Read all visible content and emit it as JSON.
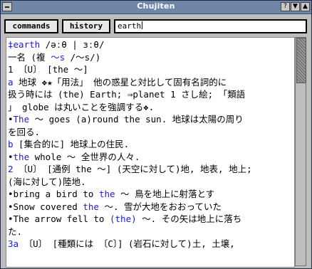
{
  "window": {
    "title": "Chujiten"
  },
  "titlebar_buttons": [
    "?",
    "▼",
    "▲"
  ],
  "toolbar": {
    "commands_label": "commands",
    "history_label": "history"
  },
  "search": {
    "value": "earth"
  },
  "entry": [
    [
      {
        "t": "‡earth",
        "c": "blue"
      },
      {
        "t": " /əːθ | ɜːθ/"
      }
    ],
    [
      {
        "t": " 一名 (複 "
      },
      {
        "t": "～s",
        "c": "blue"
      },
      {
        "t": " /～s/)"
      }
    ],
    [
      {
        "t": " 1 〔U〕 [the ～]"
      }
    ],
    [
      {
        "t": " a ",
        "c": "blue"
      },
      {
        "t": "地球 ❖★「用法」 他の惑星と対比して固有名詞的に"
      }
    ],
    [
      {
        "t": "扱う時には (the) Earth; ⇒planet 1 さし絵; 「類語"
      }
    ],
    [
      {
        "t": "」 globe は丸いことを強調する❖."
      }
    ],
    [
      {
        "t": "•"
      },
      {
        "t": "The",
        "c": "blue"
      },
      {
        "t": " ～ goes (a)round the sun. 地球は太陽の周り"
      }
    ],
    [
      {
        "t": "を回る."
      }
    ],
    [
      {
        "t": "b",
        "c": "blue"
      },
      {
        "t": " [集合的に] 地球上の住民."
      }
    ],
    [
      {
        "t": "•"
      },
      {
        "t": "the",
        "c": "blue"
      },
      {
        "t": " whole ～ 全世界の人々."
      }
    ],
    [
      {
        "t": "2",
        "c": "blue"
      },
      {
        "t": " 〔U〕 [通例 the ～] (天空に対して)地, 地表, 地上;"
      }
    ],
    [
      {
        "t": "(海に対して)陸地."
      }
    ],
    [
      {
        "t": "•bring a bird to "
      },
      {
        "t": "the",
        "c": "blue"
      },
      {
        "t": " ～ 鳥を地上に射落とす"
      }
    ],
    [
      {
        "t": "•Snow covered "
      },
      {
        "t": "the",
        "c": "blue"
      },
      {
        "t": " ～. 雪が大地をおおっていた"
      }
    ],
    [
      {
        "t": "•The arrow fell to "
      },
      {
        "t": "(the)",
        "c": "blue"
      },
      {
        "t": " ～. その矢は地上に落ち"
      }
    ],
    [
      {
        "t": "た."
      }
    ],
    [
      {
        "t": "3a",
        "c": "blue"
      },
      {
        "t": " 〔U〕 [種類には 〔C〕] (岩石に対して)土, 土壌,"
      }
    ]
  ]
}
